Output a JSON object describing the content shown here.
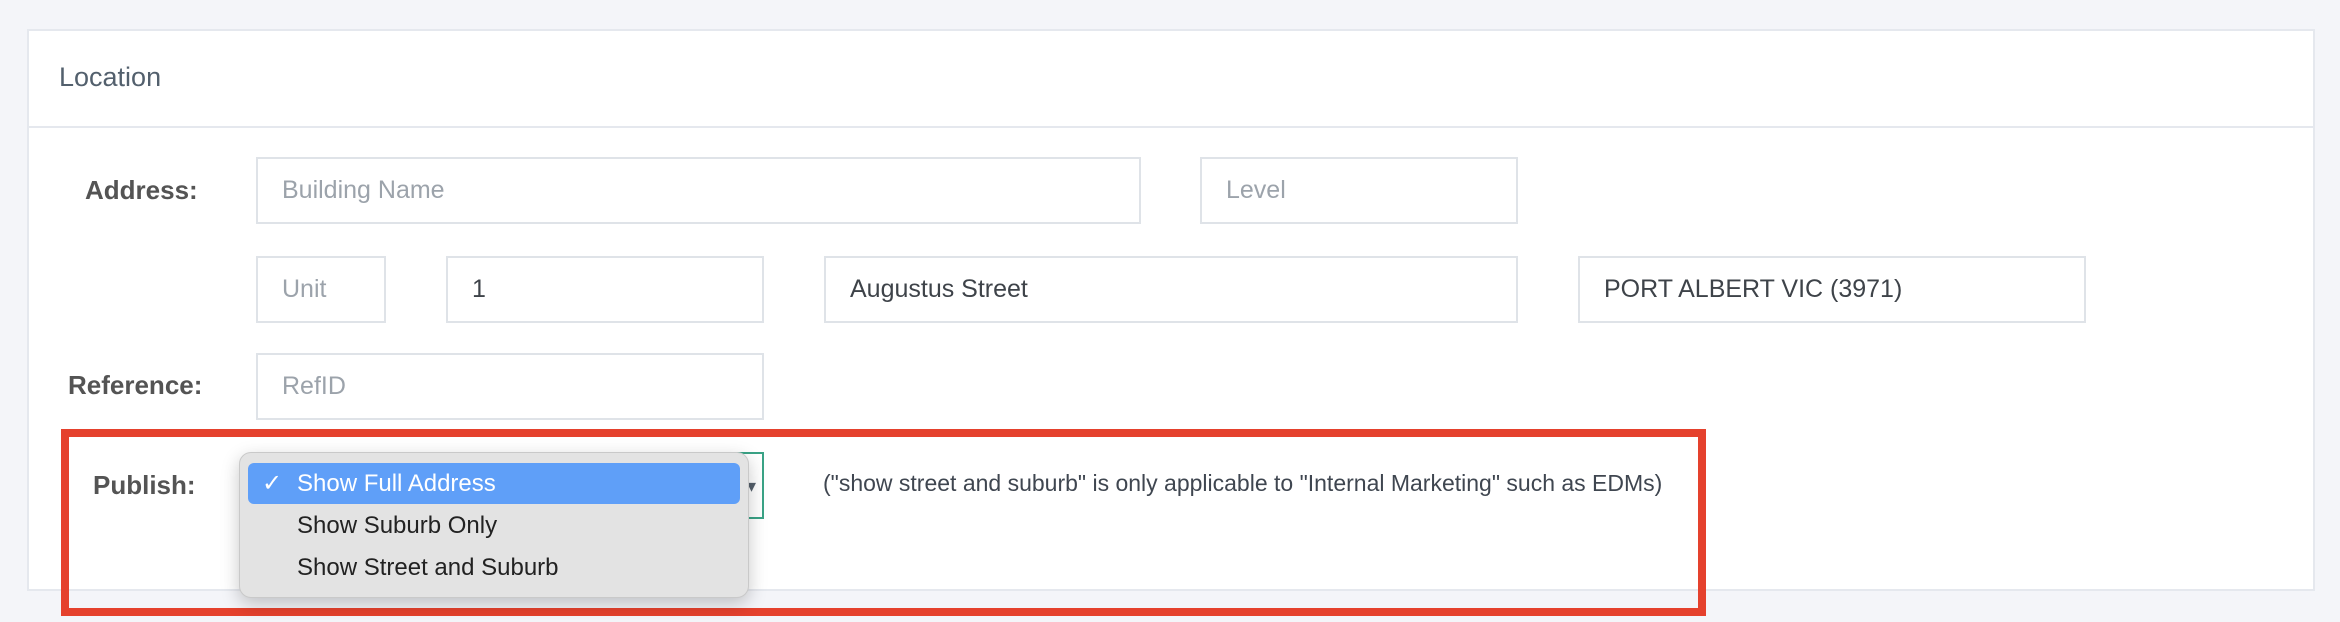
{
  "section": {
    "title": "Location"
  },
  "labels": {
    "address": "Address:",
    "reference": "Reference:",
    "publish": "Publish:"
  },
  "address": {
    "building_name": {
      "value": "",
      "placeholder": "Building Name"
    },
    "level": {
      "value": "",
      "placeholder": "Level"
    },
    "unit": {
      "value": "",
      "placeholder": "Unit"
    },
    "street_number": {
      "value": "1",
      "placeholder": ""
    },
    "street_name": {
      "value": "Augustus Street",
      "placeholder": ""
    },
    "suburb": {
      "value": "PORT ALBERT VIC (3971)",
      "placeholder": ""
    }
  },
  "reference": {
    "value": "",
    "placeholder": "RefID"
  },
  "publish": {
    "selected": "Show Full Address",
    "options": [
      "Show Full Address",
      "Show Suburb Only",
      "Show Street and Suburb"
    ],
    "check_glyph": "✓",
    "hint": "(\"show street and suburb\" is only applicable to \"Internal Marketing\" such as EDMs)"
  },
  "colors": {
    "highlight_border": "#e5412d",
    "selected_option": "#5f9ff8",
    "select_focus_border": "#3aa386"
  },
  "icons": {
    "select_caret": "chevron-down-icon",
    "selected_check": "checkmark-icon"
  }
}
